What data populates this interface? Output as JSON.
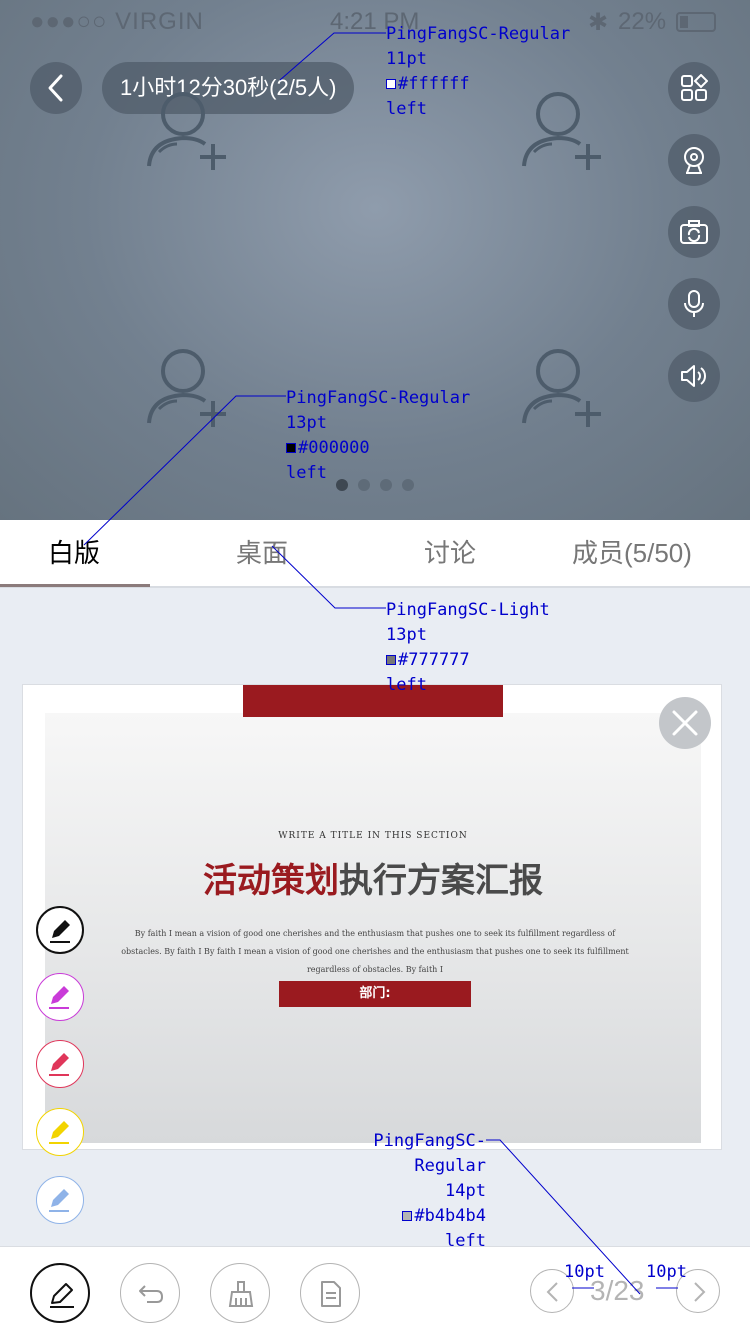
{
  "status": {
    "carrier": "●●●○○ VIRGIN",
    "time": "4:21 PM",
    "battery": "22%"
  },
  "header": {
    "back_icon": "chevron-left-icon",
    "timer": "1小时12分30秒(2/5人)"
  },
  "right_buttons": [
    "grid-icon",
    "webcam-icon",
    "switch-camera-icon",
    "microphone-icon",
    "speaker-icon"
  ],
  "tabs": [
    {
      "label": "白版",
      "active": true
    },
    {
      "label": "桌面",
      "active": false
    },
    {
      "label": "讨论",
      "active": false
    },
    {
      "label": "成员(5/50)",
      "active": false
    }
  ],
  "slide": {
    "subtitle": "WRITE A TITLE IN THIS SECTION",
    "title_red": "活动策划",
    "title_gray": "执行方案汇报",
    "body": "By faith I mean a vision of good one cherishes and the enthusiasm that pushes one to seek its fulfillment regardless of obstacles. By faith I By faith I mean a vision of good one cherishes and the enthusiasm that pushes one to seek its fulfillment regardless of obstacles. By faith I",
    "dept": "部门:"
  },
  "pens": [
    "#111111",
    "#c93bd8",
    "#e0365a",
    "#f2d400",
    "#8fb3e8"
  ],
  "pager": {
    "current": "3",
    "total": "23",
    "text": "3/23"
  },
  "annotations": {
    "a1": {
      "font": "PingFangSC-Regular",
      "size": "11pt",
      "color": "#ffffff",
      "align": "left"
    },
    "a2": {
      "font": "PingFangSC-Regular",
      "size": "13pt",
      "color": "#000000",
      "align": "left"
    },
    "a3": {
      "font": "PingFangSC-Light",
      "size": "13pt",
      "color": "#777777",
      "align": "left"
    },
    "a4": {
      "font": "PingFangSC-Regular",
      "size": "14pt",
      "color": "#b4b4b4",
      "align": "left"
    },
    "gap_left": "10pt",
    "gap_right": "10pt"
  },
  "colors": {
    "accent_red": "#9a1a1f",
    "tab_inactive": "#777777",
    "pager": "#b4b4b4"
  }
}
